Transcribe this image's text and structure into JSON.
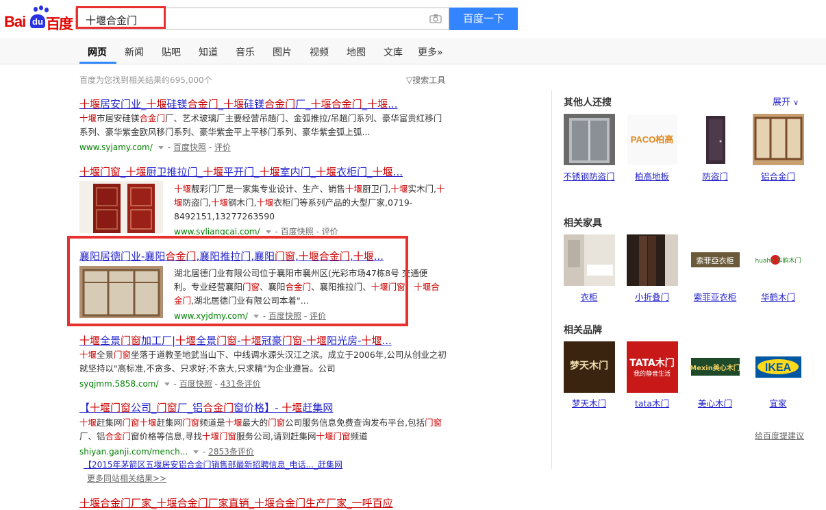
{
  "header": {
    "logo_text": "Baidu百度",
    "search_query": "十堰合金门",
    "search_button": "百度一下"
  },
  "nav": {
    "tabs": [
      "网页",
      "新闻",
      "贴吧",
      "知道",
      "音乐",
      "图片",
      "视频",
      "地图",
      "文库",
      "更多»"
    ]
  },
  "stats": {
    "result_count": "百度为您找到相关结果约695,000个",
    "search_tools": "搜索工具"
  },
  "results": [
    {
      "title": "十堰居安门业_十堰硅镁合金门_十堰硅镁合金门厂_十堰合金门_十堰...",
      "abstract": "十堰市居安硅镁合金门厂、艺术玻璃厂主要经营吊趟门、金弧推拉/吊趟门系列、豪华富贵红移门系列、豪华紫金欧风移门系列、豪华紫金平上平移门系列、豪华紫金弧上弧...",
      "url": "www.syjamy.com/",
      "snapshot": "百度快照",
      "rate": "评价"
    },
    {
      "title": "十堰门窗_十堰厨卫推拉门_十堰平开门_十堰室内门_十堰衣柜门_十堰...",
      "abstract": "十堰靓彩门厂是一家集专业设计、生产、销售十堰厨卫门,十堰实木门,十堰防盗门,十堰钢木门,十堰衣柜门等系列产品的大型厂家,0719-8492151,13277263590",
      "url": "www.syliangcai.com/",
      "snapshot": "百度快照",
      "rate": "评价"
    },
    {
      "title": "襄阳居德门业-襄阳合金门,襄阳推拉门,襄阳门窗,十堰合金门,十堰...",
      "abstract": "湖北居德门业有限公司位于襄阳市襄州区(光彩市场47栋8号 交通便利。专业经营襄阳门窗、襄阳合金门、襄阳推拉门、十堰门窗、十堰合金门,湖北居德门业有限公司本着\"...",
      "url": "www.xyjdmy.com/",
      "snapshot": "百度快照",
      "rate": "评价"
    },
    {
      "title": "十堰全景门窗加工厂|十堰全景门窗-十堰冠豪门窗-十堰阳光房-十堰...",
      "abstract": "十堰全景门窗坐落于道教圣地武当山下、中线调水源头汉江之滨。成立于2006年,公司从创业之初就坚持以\"高标准,不贪多、只求好;不贪大,只求精\"为企业遵旨。公司",
      "url": "syqjmm.5858.com/",
      "snapshot": "百度快照",
      "rate": "431条评价"
    },
    {
      "title": "【十堰门窗公司_门窗厂_铝合金门窗价格】- 十堰赶集网",
      "abstract": "十堰赶集网门窗十堰赶集网门窗频道是十堰最大的门窗公司服务信息免费查询发布平台,包括门窗厂、铝合金门窗价格等信息,寻找十堰门窗服务公司,请到赶集网十堰门窗频道",
      "url": "shiyan.ganji.com/mench...",
      "snapshot": "",
      "rate": "2853条评价",
      "sublink": "【2015年茅箭区五堰居安铝合金门销售部最新招聘信息_电话..._赶集网",
      "more": "更多同站相关结果>>"
    },
    {
      "title": "十堰合金门厂家_十堰合金门厂家直销_十堰合金门生产厂家_一呼百应"
    }
  ],
  "sidebar": {
    "expand": "展开",
    "feedback": "给百度提建议",
    "sections": [
      {
        "title": "其他人还搜",
        "items": [
          "不锈钢防盗门",
          "柏高地板",
          "防盗门",
          "铝合金门"
        ]
      },
      {
        "title": "相关家具",
        "items": [
          "衣柜",
          "小折叠门",
          "索菲亚衣柜",
          "华鹤木门"
        ]
      },
      {
        "title": "相关品牌",
        "items": [
          "梦天木门",
          "tata木门",
          "美心木门",
          "宜家"
        ]
      }
    ],
    "logo_texts": {
      "paco": "PACO柏高",
      "sofia": "索菲亞衣柜",
      "huahe": "huahe 华鹤木门",
      "mengtian": "梦天木门",
      "tata": "TATA木门",
      "tata_sub": "我的静音生活",
      "mexin": "Mexin美心木门",
      "ikea": "IKEA"
    }
  },
  "colors": {
    "link": "#2424cc",
    "highlight": "#cc0000",
    "url": "#008000",
    "button": "#3385ff",
    "annotation": "#e8312f"
  }
}
